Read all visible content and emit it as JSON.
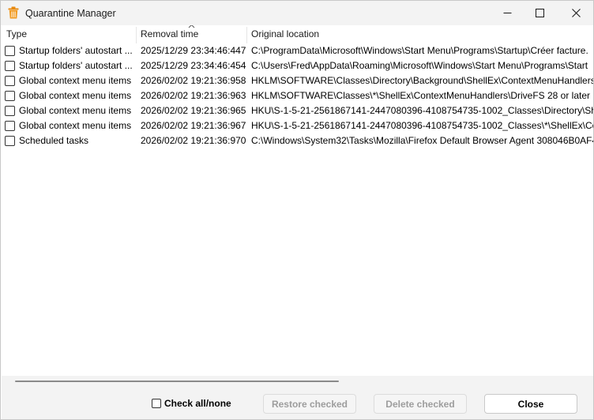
{
  "window": {
    "title": "Quarantine Manager"
  },
  "columns": {
    "type": "Type",
    "removal_time": "Removal time",
    "original_location": "Original location"
  },
  "rows": [
    {
      "type": "Startup folders' autostart ...",
      "time": "2025/12/29 23:34:46:447",
      "location": "C:\\ProgramData\\Microsoft\\Windows\\Start Menu\\Programs\\Startup\\Créer facture.",
      "checked": false
    },
    {
      "type": "Startup folders' autostart ...",
      "time": "2025/12/29 23:34:46:454",
      "location": "C:\\Users\\Fred\\AppData\\Roaming\\Microsoft\\Windows\\Start Menu\\Programs\\Start",
      "checked": false
    },
    {
      "type": "Global context menu items",
      "time": "2026/02/02 19:21:36:958",
      "location": "HKLM\\SOFTWARE\\Classes\\Directory\\Background\\ShellEx\\ContextMenuHandlers\\",
      "checked": false
    },
    {
      "type": "Global context menu items",
      "time": "2026/02/02 19:21:36:963",
      "location": "HKLM\\SOFTWARE\\Classes\\*\\ShellEx\\ContextMenuHandlers\\DriveFS 28 or later",
      "checked": false
    },
    {
      "type": "Global context menu items",
      "time": "2026/02/02 19:21:36:965",
      "location": "HKU\\S-1-5-21-2561867141-2447080396-4108754735-1002_Classes\\Directory\\ShellEx",
      "checked": false
    },
    {
      "type": "Global context menu items",
      "time": "2026/02/02 19:21:36:967",
      "location": "HKU\\S-1-5-21-2561867141-2447080396-4108754735-1002_Classes\\*\\ShellEx\\Contex",
      "checked": false
    },
    {
      "type": "Scheduled tasks",
      "time": "2026/02/02 19:21:36:970",
      "location": "C:\\Windows\\System32\\Tasks\\Mozilla\\Firefox Default Browser Agent 308046B0AF4A",
      "checked": false
    }
  ],
  "footer": {
    "check_all_label": "Check all/none",
    "restore_label": "Restore checked",
    "delete_label": "Delete checked",
    "close_label": "Close"
  },
  "colors": {
    "icon_orange": "#e8890c",
    "titlebar_bg": "#f3f3f3",
    "disabled_text": "#9d9d9d"
  }
}
